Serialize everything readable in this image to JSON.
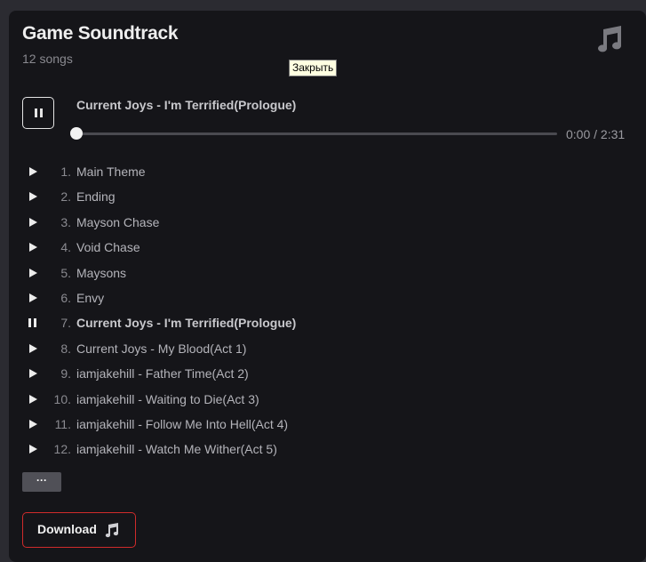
{
  "header": {
    "title": "Game Soundtrack",
    "subtitle": "12 songs",
    "icon": "music-note-icon"
  },
  "tooltip": {
    "text": "Закрыть"
  },
  "player": {
    "now_playing": "Current Joys - I'm Terrified(Prologue)",
    "time": "0:00 / 2:31",
    "progress": 0,
    "state": "playing"
  },
  "tracks": [
    {
      "num": "1.",
      "name": "Main Theme"
    },
    {
      "num": "2.",
      "name": "Ending"
    },
    {
      "num": "3.",
      "name": "Mayson Chase"
    },
    {
      "num": "4.",
      "name": "Void Chase"
    },
    {
      "num": "5.",
      "name": "Maysons"
    },
    {
      "num": "6.",
      "name": "Envy"
    },
    {
      "num": "7.",
      "name": "Current Joys - I'm Terrified(Prologue)"
    },
    {
      "num": "8.",
      "name": "Current Joys - My Blood(Act 1)"
    },
    {
      "num": "9.",
      "name": "iamjakehill - Father Time(Act 2)"
    },
    {
      "num": "10.",
      "name": "iamjakehill - Waiting to Die(Act 3)"
    },
    {
      "num": "11.",
      "name": "iamjakehill - Follow Me Into Hell(Act 4)"
    },
    {
      "num": "12.",
      "name": "iamjakehill - Watch Me Wither(Act 5)"
    }
  ],
  "active_track": 7,
  "buttons": {
    "more_label": "···",
    "download_label": "Download"
  },
  "colors": {
    "background": "#151519",
    "accent_border": "#d02b2b",
    "text": "#b4b4ba"
  }
}
